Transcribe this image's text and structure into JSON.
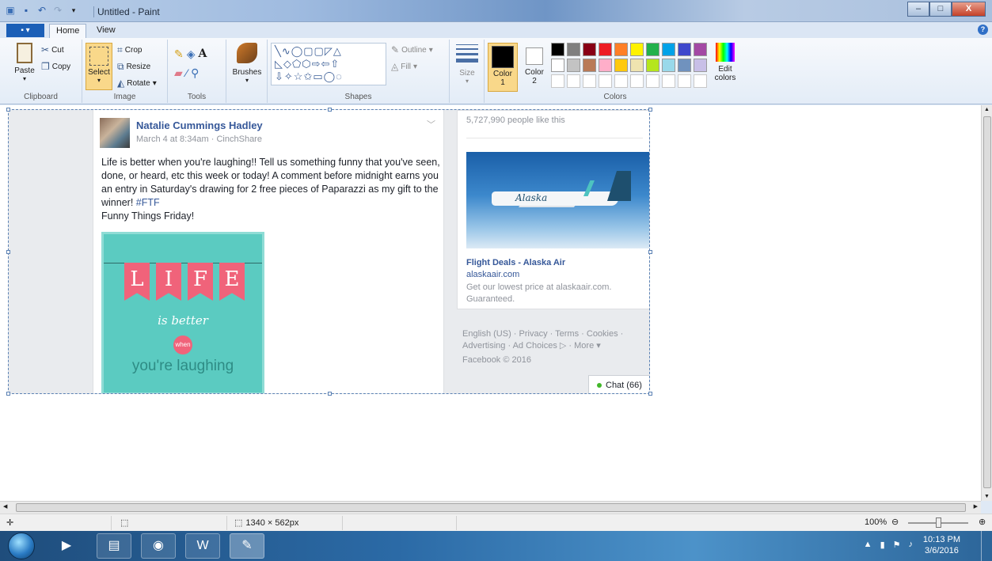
{
  "window": {
    "title": "Untitled - Paint",
    "buttons": {
      "minimize": "–",
      "maximize": "□",
      "close": "X"
    }
  },
  "tabs": {
    "file": "▪ ▾",
    "home": "Home",
    "view": "View"
  },
  "ribbon": {
    "clipboard": {
      "label": "Clipboard",
      "paste": "Paste",
      "cut": "Cut",
      "copy": "Copy"
    },
    "image": {
      "label": "Image",
      "select": "Select",
      "crop": "Crop",
      "resize": "Resize",
      "rotate": "Rotate"
    },
    "tools": {
      "label": "Tools"
    },
    "brushes": {
      "label": "Brushes"
    },
    "shapes": {
      "label": "Shapes",
      "outline": "Outline",
      "fill": "Fill"
    },
    "size": {
      "label": "Size"
    },
    "colors": {
      "label": "Colors",
      "color1": "Color 1",
      "color2": "Color 2",
      "edit": "Edit colors",
      "color1_value": "#000000",
      "color2_value": "#ffffff",
      "palette_row1": [
        "#000000",
        "#7f7f7f",
        "#880015",
        "#ed1c24",
        "#ff7f27",
        "#fff200",
        "#22b14c",
        "#00a2e8",
        "#3f48cc",
        "#a349a4"
      ],
      "palette_row2": [
        "#ffffff",
        "#c3c3c3",
        "#b97a57",
        "#ffaec9",
        "#ffc90e",
        "#efe4b0",
        "#b5e61d",
        "#99d9ea",
        "#7092be",
        "#c8bfe7"
      ]
    }
  },
  "canvas": {
    "post": {
      "author": "Natalie Cummings Hadley",
      "meta": "March 4 at 8:34am · CinchShare",
      "text": "Life is better when you're laughing!! Tell us something funny that you've seen, done, or heard, etc this week or today! A comment before midnight earns you an entry in Saturday's drawing for 2 free pieces of Paparazzi as my gift to the winner! ",
      "hashtag": "#FTF",
      "text2": "Funny Things Friday!",
      "image_letters": [
        "L",
        "I",
        "F",
        "E"
      ],
      "image_line1": "is better",
      "image_when": "when",
      "image_line2": "you're laughing"
    },
    "sidebar": {
      "likes": "5,727,990 people like this",
      "ad_brand": "Alaska",
      "ad_title": "Flight Deals - Alaska Air",
      "ad_url": "alaskaair.com",
      "ad_desc": "Get our lowest price at alaskaair.com. Guaranteed.",
      "footer": "English (US) · Privacy · Terms · Cookies · Advertising · Ad Choices ▷ · More ▾",
      "copyright": "Facebook © 2016",
      "chat": "Chat (66)"
    }
  },
  "status": {
    "dimensions": "1340 × 562px",
    "zoom": "100%"
  },
  "taskbar": {
    "time": "10:13 PM",
    "date": "3/6/2016"
  }
}
